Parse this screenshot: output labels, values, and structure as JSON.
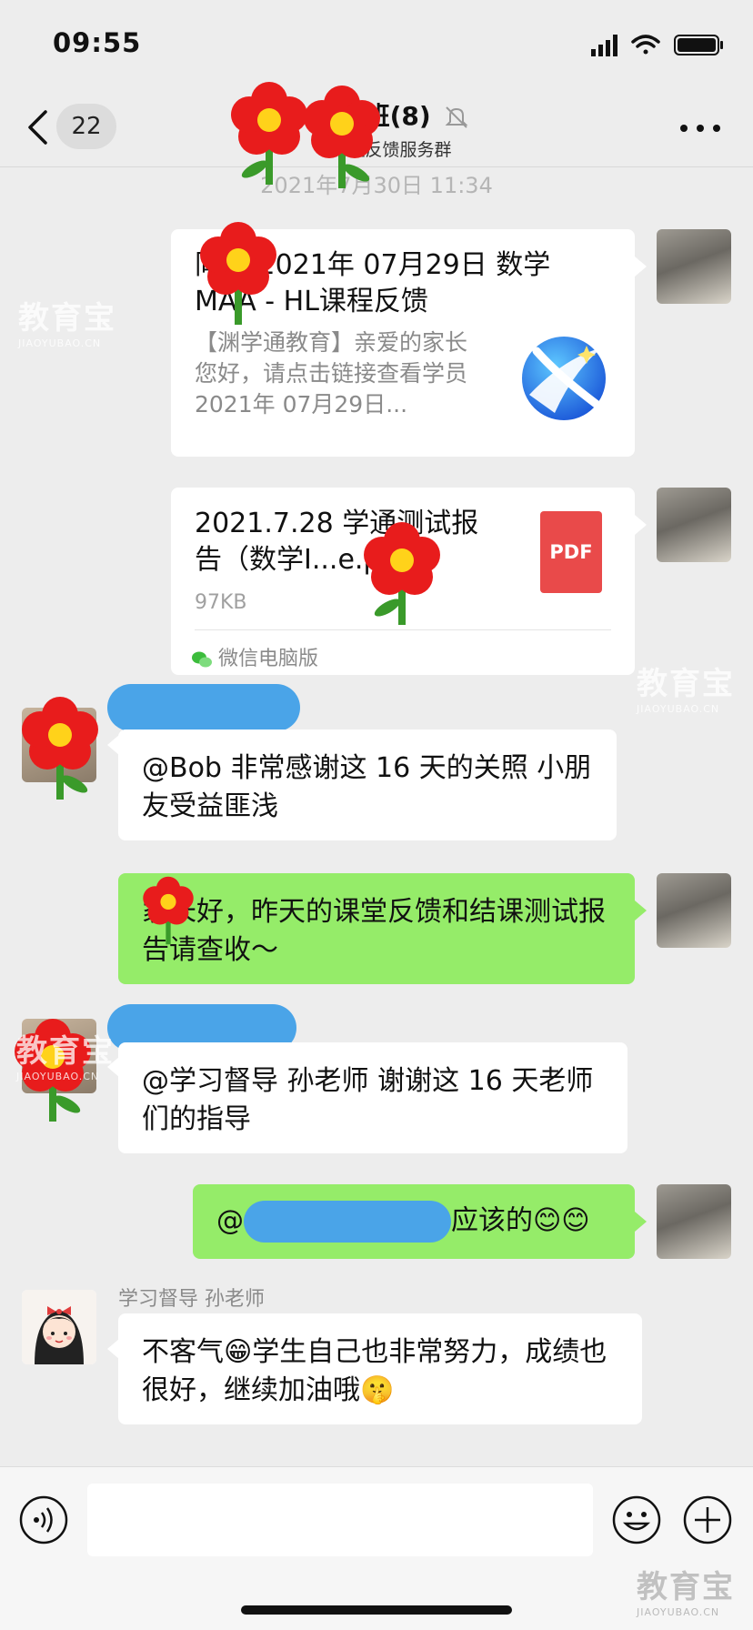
{
  "status_bar": {
    "time": "09:55"
  },
  "header": {
    "unread_count": "22",
    "title": "预学班(8)",
    "subtitle": "课程反馈服务群"
  },
  "timestamp": "2021年7月30日 11:34",
  "messages": [
    {
      "type": "link_card",
      "title": "同学 2021年 07月29日 数学MAA - HL课程反馈",
      "desc": "【渊学通教育】亲爱的家长您好，请点击链接查看学员 2021年 07月29日..."
    },
    {
      "type": "file_card",
      "title": "2021.7.28 学通测试报告（数学I...",
      "title_suffix": "e.pdf",
      "size": "97KB",
      "source": "微信电脑版",
      "icon_label": "PDF"
    },
    {
      "type": "text",
      "text": "@Bob 非常感谢这 16 天的关照 小朋友受益匪浅"
    },
    {
      "type": "text",
      "text": "家长好，昨天的课堂反馈和结课测试报告请查收～"
    },
    {
      "type": "text",
      "text": "@学习督导 孙老师 谢谢这 16 天老师们的指导"
    },
    {
      "type": "text",
      "prefix": "@",
      "text": "应该的😊😊"
    },
    {
      "type": "text",
      "sender": "学习督导 孙老师",
      "text": "不客气😁学生自己也非常努力，成绩也很好，继续加油哦🤫"
    }
  ],
  "watermark": {
    "text": "教育宝",
    "sub": "JIAOYUBAO.CN"
  },
  "colors": {
    "bg": "#ededed",
    "green_bubble": "#95ec69",
    "blur": "#4aa4e8"
  }
}
